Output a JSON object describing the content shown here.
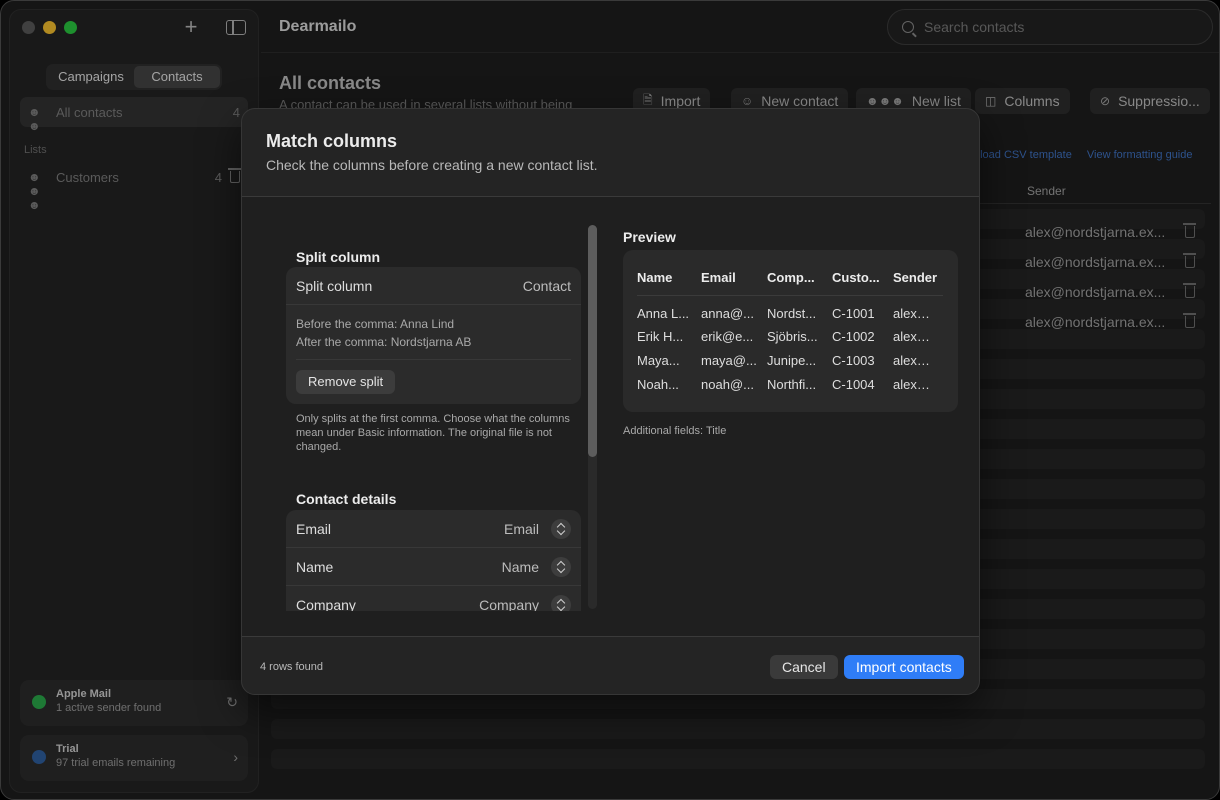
{
  "app": {
    "title": "Dearmailo"
  },
  "sidebar": {
    "tabs": [
      "Campaigns",
      "Contacts"
    ],
    "all_contacts": {
      "label": "All contacts",
      "count": "4"
    },
    "lists_heading": "Lists",
    "lists": [
      {
        "label": "Customers",
        "count": "4"
      }
    ],
    "sender_card": {
      "title": "Apple Mail",
      "subtitle": "1 active sender found"
    },
    "trial_card": {
      "title": "Trial",
      "subtitle": "97 trial emails remaining"
    }
  },
  "header": {
    "search_placeholder": "Search contacts"
  },
  "main": {
    "title": "All contacts",
    "subtitle": "A contact can be used in several lists without being",
    "toolbar": [
      "Import",
      "New contact",
      "New list",
      "Columns",
      "Suppressio..."
    ],
    "links": [
      "nload CSV template",
      "View formatting guide"
    ],
    "sender_header": "Sender",
    "sender_emails": [
      "alex@nordstjarna.ex...",
      "alex@nordstjarna.ex...",
      "alex@nordstjarna.ex...",
      "alex@nordstjarna.ex..."
    ]
  },
  "modal": {
    "title": "Match columns",
    "subtitle": "Check the columns before creating a new contact list.",
    "split": {
      "heading": "Split column",
      "row_label": "Split column",
      "row_value": "Contact",
      "before": "Before the comma: Anna Lind",
      "after": "After the comma: Nordstjarna AB",
      "remove_label": "Remove split",
      "note": "Only splits at the first comma. Choose what the columns mean under Basic information. The original file is not changed."
    },
    "details": {
      "heading": "Contact details",
      "rows": [
        {
          "label": "Email",
          "value": "Email"
        },
        {
          "label": "Name",
          "value": "Name"
        },
        {
          "label": "Company",
          "value": "Company"
        }
      ]
    },
    "preview": {
      "heading": "Preview",
      "columns": [
        "Name",
        "Email",
        "Comp...",
        "Custo...",
        "Sender"
      ],
      "rows": [
        [
          "Anna L...",
          "anna@...",
          "Nordst...",
          "C-1001",
          "alex@n..."
        ],
        [
          "Erik H...",
          "erik@e...",
          "Sjöbris...",
          "C-1002",
          "alex@n..."
        ],
        [
          "Maya...",
          "maya@...",
          "Junipe...",
          "C-1003",
          "alex@n..."
        ],
        [
          "Noah...",
          "noah@...",
          "Northfi...",
          "C-1004",
          "alex@n..."
        ]
      ],
      "additional": "Additional fields: Title"
    },
    "footer": {
      "rows_found": "4 rows found",
      "cancel": "Cancel",
      "import": "Import contacts"
    }
  }
}
